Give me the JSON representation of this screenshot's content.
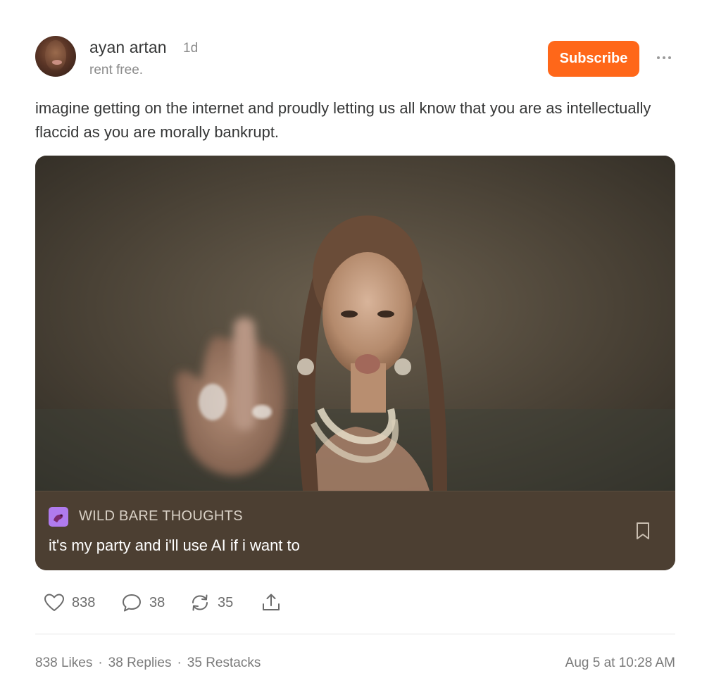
{
  "author": {
    "name": "ayan artan",
    "time": "1d",
    "bio": "rent free."
  },
  "subscribe_label": "Subscribe",
  "post": {
    "text": "imagine getting on the internet and proudly letting us all know that you are as intellectually flaccid as you are morally bankrupt."
  },
  "card": {
    "publication": "WILD BARE THOUGHTS",
    "title": "it's my party and i'll use AI if i want to"
  },
  "actions": {
    "likes": "838",
    "comments": "38",
    "restacks": "35"
  },
  "stats": {
    "likes": "838 Likes",
    "replies": "38 Replies",
    "restacks": "35 Restacks",
    "separator": "·",
    "date": "Aug 5 at 10:28 AM"
  },
  "colors": {
    "accent": "#ff6719",
    "card_footer": "#4c3f32",
    "publication_logo": "#b07bef"
  },
  "icons": [
    "more-icon",
    "heart-icon",
    "comment-icon",
    "restack-icon",
    "share-icon",
    "bookmark-icon"
  ]
}
